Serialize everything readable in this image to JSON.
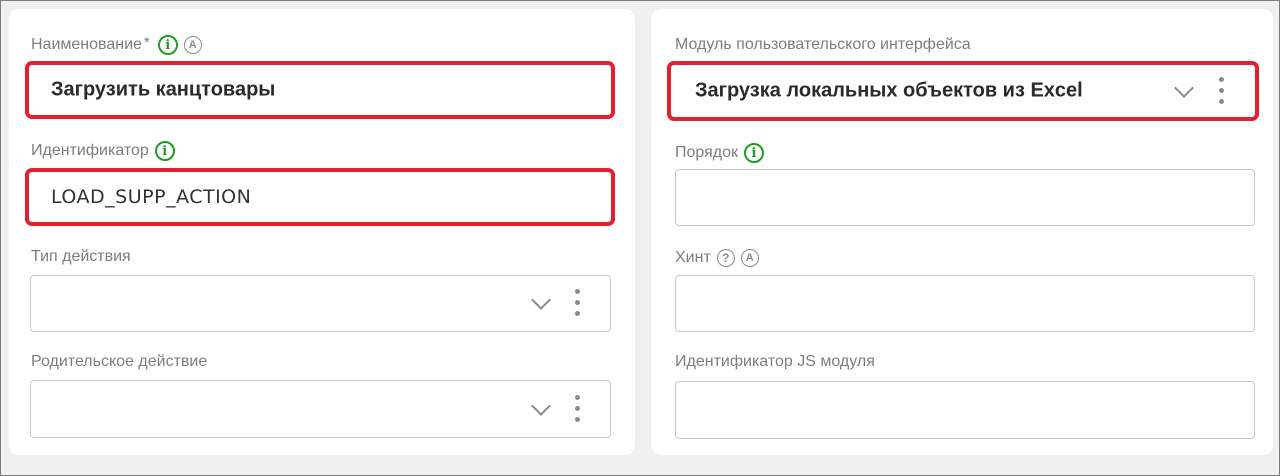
{
  "left": {
    "name": {
      "label": "Наименование",
      "required_mark": "*",
      "value": "Загрузить канцтовары"
    },
    "identifier": {
      "label": "Идентификатор",
      "value": "LOAD_SUPP_ACTION"
    },
    "action_type": {
      "label": "Тип действия",
      "value": ""
    },
    "parent_action": {
      "label": "Родительское действие",
      "value": ""
    }
  },
  "right": {
    "ui_module": {
      "label": "Модуль пользовательского интерфейса",
      "value": "Загрузка локальных объектов из Excel"
    },
    "order": {
      "label": "Порядок",
      "value": ""
    },
    "hint": {
      "label": "Хинт",
      "value": ""
    },
    "js_module_id": {
      "label": "Идентификатор JS модуля",
      "value": ""
    }
  },
  "icons": {
    "info": "i",
    "auto": "A",
    "help": "?"
  },
  "colors": {
    "highlight": "#e5202e",
    "info_green": "#1e9c24",
    "label_gray": "#7d7d7d"
  }
}
